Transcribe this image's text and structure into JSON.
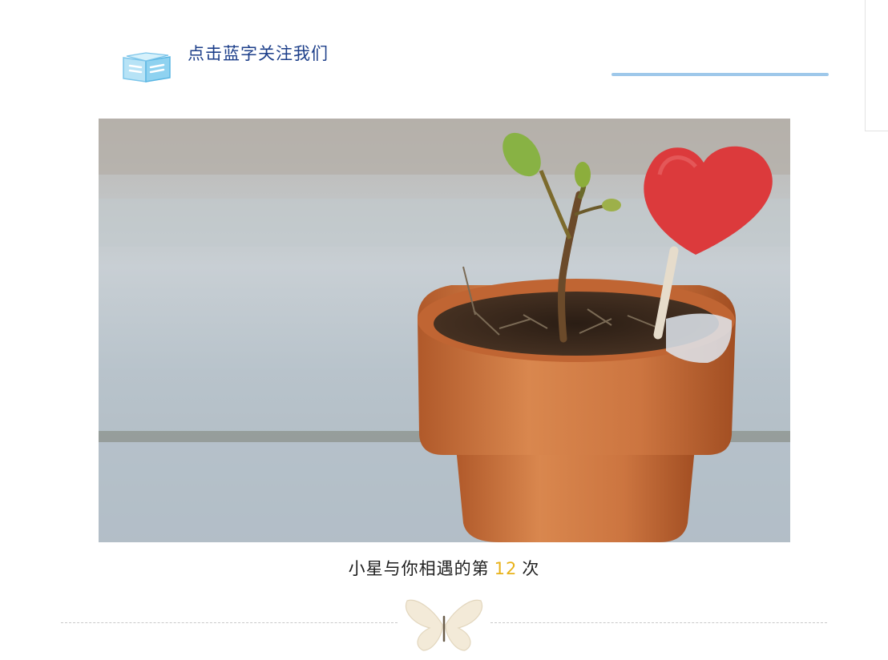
{
  "header": {
    "logo_icon": "book-icon",
    "follow_link": "点击蓝字关注我们"
  },
  "photo": {
    "subject": "potted-seedling-with-heart-icon"
  },
  "caption": {
    "prefix": "小星与你相遇的第",
    "count": "12",
    "suffix": "次"
  },
  "divider": {
    "icon": "butterfly-icon"
  },
  "colors": {
    "link": "#1d3f8a",
    "accent_line": "#9ec8ea",
    "count": "#e8b21a"
  }
}
